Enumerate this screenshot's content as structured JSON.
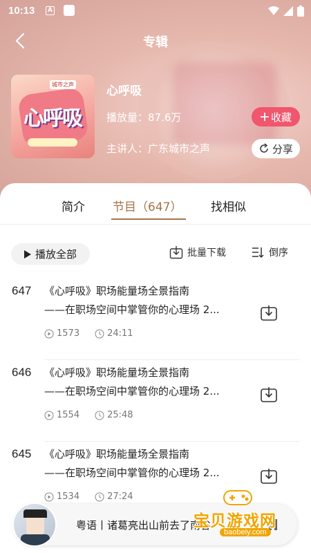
{
  "status_bar": {
    "time": "10:13",
    "a_icon": "A"
  },
  "header": {
    "title": "专辑"
  },
  "album": {
    "name": "心呼吸",
    "plays_label": "播放量：87.6万",
    "speaker_label": "主讲人：广东城市之声",
    "cover_text": "心呼吸",
    "cover_logo": "城市之声"
  },
  "buttons": {
    "favorite": "收藏",
    "share": "分享"
  },
  "tabs": [
    {
      "label": "简介",
      "active": false
    },
    {
      "label": "节目（647）",
      "active": true
    },
    {
      "label": "找相似",
      "active": false
    }
  ],
  "actions": {
    "play_all": "播放全部",
    "batch_download": "批量下载",
    "sort": "倒序"
  },
  "episodes": [
    {
      "number": "647",
      "title_line1": "《心呼吸》职场能量场全景指南",
      "title_line2": "——在职场空间中掌管你的心理场 2...",
      "plays": "1573",
      "duration": "24:11"
    },
    {
      "number": "646",
      "title_line1": "《心呼吸》职场能量场全景指南",
      "title_line2": "——在职场空间中掌管你的心理场 2...",
      "plays": "1554",
      "duration": "25:48"
    },
    {
      "number": "645",
      "title_line1": "《心呼吸》职场能量场全景指南",
      "title_line2": "——在职场空间中掌管你的心理场 2...",
      "plays": "1534",
      "duration": "27:24"
    }
  ],
  "player": {
    "track": "粤语丨诸葛亮出山前去了南谷"
  },
  "watermark": {
    "text": "宝贝游戏网",
    "url": "baobeiy.com"
  },
  "colors": {
    "accent": "#a7744a",
    "favorite": "#f0566d",
    "watermark": "#f0a500"
  }
}
